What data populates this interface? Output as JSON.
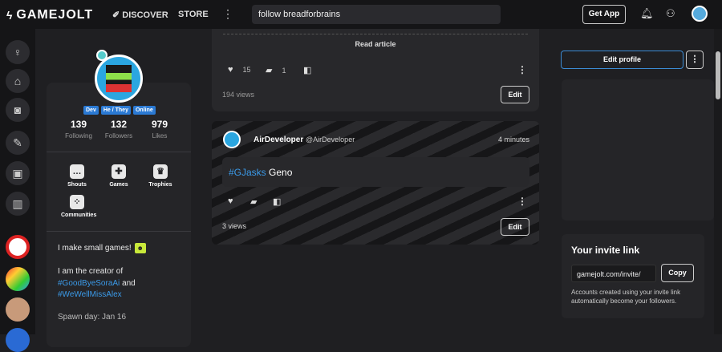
{
  "topbar": {
    "logo": "GAMEJOLT",
    "discover": "DISCOVER",
    "store": "STORE",
    "search_value": "follow breadforbrains",
    "get_app": "Get App"
  },
  "profile": {
    "tags": [
      "Dev",
      "He / They",
      "Online"
    ],
    "stats": [
      {
        "num": "139",
        "label": "Following"
      },
      {
        "num": "132",
        "label": "Followers"
      },
      {
        "num": "979",
        "label": "Likes"
      }
    ],
    "tiles": [
      {
        "label": "Shouts"
      },
      {
        "label": "Games"
      },
      {
        "label": "Trophies"
      },
      {
        "label": "Communities"
      }
    ],
    "bio_line1": "I make small games!",
    "bio_line2": "I am the creator of",
    "bio_tag1": "#GoodByeSoraAi",
    "bio_and": "and",
    "bio_tag2": "#WeWellMissAlex",
    "spawn_day": "Spawn day: Jan 16"
  },
  "post1": {
    "read_article": "Read article",
    "likes": "15",
    "comments": "1",
    "views": "194 views",
    "edit": "Edit"
  },
  "post2": {
    "author": "AirDeveloper",
    "handle": "@AirDeveloper",
    "time": "4 minutes",
    "hashtag": "#GJasks",
    "text": "Geno",
    "views": "3 views",
    "edit": "Edit"
  },
  "right": {
    "edit_profile": "Edit profile",
    "invite_title": "Your invite link",
    "invite_link": "gamejolt.com/invite/",
    "copy": "Copy",
    "invite_desc": "Accounts created using your invite link automatically become your followers."
  }
}
